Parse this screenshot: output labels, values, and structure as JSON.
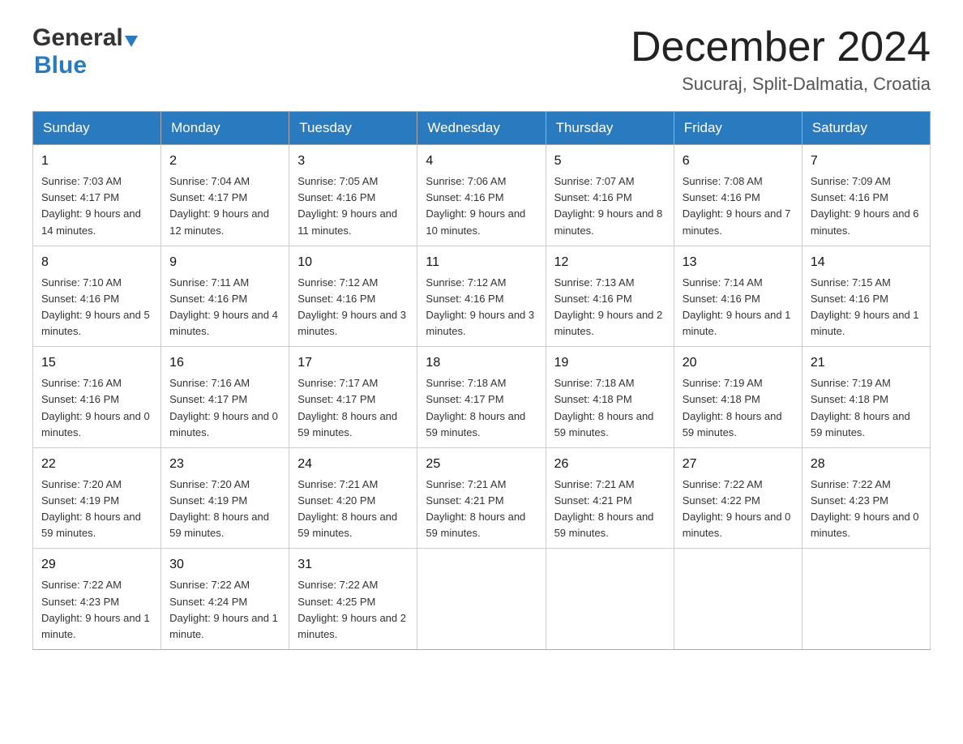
{
  "logo": {
    "general": "General",
    "blue": "Blue"
  },
  "header": {
    "month": "December 2024",
    "location": "Sucuraj, Split-Dalmatia, Croatia"
  },
  "days_of_week": [
    "Sunday",
    "Monday",
    "Tuesday",
    "Wednesday",
    "Thursday",
    "Friday",
    "Saturday"
  ],
  "weeks": [
    [
      {
        "day": "1",
        "sunrise": "7:03 AM",
        "sunset": "4:17 PM",
        "daylight": "9 hours and 14 minutes."
      },
      {
        "day": "2",
        "sunrise": "7:04 AM",
        "sunset": "4:17 PM",
        "daylight": "9 hours and 12 minutes."
      },
      {
        "day": "3",
        "sunrise": "7:05 AM",
        "sunset": "4:16 PM",
        "daylight": "9 hours and 11 minutes."
      },
      {
        "day": "4",
        "sunrise": "7:06 AM",
        "sunset": "4:16 PM",
        "daylight": "9 hours and 10 minutes."
      },
      {
        "day": "5",
        "sunrise": "7:07 AM",
        "sunset": "4:16 PM",
        "daylight": "9 hours and 8 minutes."
      },
      {
        "day": "6",
        "sunrise": "7:08 AM",
        "sunset": "4:16 PM",
        "daylight": "9 hours and 7 minutes."
      },
      {
        "day": "7",
        "sunrise": "7:09 AM",
        "sunset": "4:16 PM",
        "daylight": "9 hours and 6 minutes."
      }
    ],
    [
      {
        "day": "8",
        "sunrise": "7:10 AM",
        "sunset": "4:16 PM",
        "daylight": "9 hours and 5 minutes."
      },
      {
        "day": "9",
        "sunrise": "7:11 AM",
        "sunset": "4:16 PM",
        "daylight": "9 hours and 4 minutes."
      },
      {
        "day": "10",
        "sunrise": "7:12 AM",
        "sunset": "4:16 PM",
        "daylight": "9 hours and 3 minutes."
      },
      {
        "day": "11",
        "sunrise": "7:12 AM",
        "sunset": "4:16 PM",
        "daylight": "9 hours and 3 minutes."
      },
      {
        "day": "12",
        "sunrise": "7:13 AM",
        "sunset": "4:16 PM",
        "daylight": "9 hours and 2 minutes."
      },
      {
        "day": "13",
        "sunrise": "7:14 AM",
        "sunset": "4:16 PM",
        "daylight": "9 hours and 1 minute."
      },
      {
        "day": "14",
        "sunrise": "7:15 AM",
        "sunset": "4:16 PM",
        "daylight": "9 hours and 1 minute."
      }
    ],
    [
      {
        "day": "15",
        "sunrise": "7:16 AM",
        "sunset": "4:16 PM",
        "daylight": "9 hours and 0 minutes."
      },
      {
        "day": "16",
        "sunrise": "7:16 AM",
        "sunset": "4:17 PM",
        "daylight": "9 hours and 0 minutes."
      },
      {
        "day": "17",
        "sunrise": "7:17 AM",
        "sunset": "4:17 PM",
        "daylight": "8 hours and 59 minutes."
      },
      {
        "day": "18",
        "sunrise": "7:18 AM",
        "sunset": "4:17 PM",
        "daylight": "8 hours and 59 minutes."
      },
      {
        "day": "19",
        "sunrise": "7:18 AM",
        "sunset": "4:18 PM",
        "daylight": "8 hours and 59 minutes."
      },
      {
        "day": "20",
        "sunrise": "7:19 AM",
        "sunset": "4:18 PM",
        "daylight": "8 hours and 59 minutes."
      },
      {
        "day": "21",
        "sunrise": "7:19 AM",
        "sunset": "4:18 PM",
        "daylight": "8 hours and 59 minutes."
      }
    ],
    [
      {
        "day": "22",
        "sunrise": "7:20 AM",
        "sunset": "4:19 PM",
        "daylight": "8 hours and 59 minutes."
      },
      {
        "day": "23",
        "sunrise": "7:20 AM",
        "sunset": "4:19 PM",
        "daylight": "8 hours and 59 minutes."
      },
      {
        "day": "24",
        "sunrise": "7:21 AM",
        "sunset": "4:20 PM",
        "daylight": "8 hours and 59 minutes."
      },
      {
        "day": "25",
        "sunrise": "7:21 AM",
        "sunset": "4:21 PM",
        "daylight": "8 hours and 59 minutes."
      },
      {
        "day": "26",
        "sunrise": "7:21 AM",
        "sunset": "4:21 PM",
        "daylight": "8 hours and 59 minutes."
      },
      {
        "day": "27",
        "sunrise": "7:22 AM",
        "sunset": "4:22 PM",
        "daylight": "9 hours and 0 minutes."
      },
      {
        "day": "28",
        "sunrise": "7:22 AM",
        "sunset": "4:23 PM",
        "daylight": "9 hours and 0 minutes."
      }
    ],
    [
      {
        "day": "29",
        "sunrise": "7:22 AM",
        "sunset": "4:23 PM",
        "daylight": "9 hours and 1 minute."
      },
      {
        "day": "30",
        "sunrise": "7:22 AM",
        "sunset": "4:24 PM",
        "daylight": "9 hours and 1 minute."
      },
      {
        "day": "31",
        "sunrise": "7:22 AM",
        "sunset": "4:25 PM",
        "daylight": "9 hours and 2 minutes."
      },
      null,
      null,
      null,
      null
    ]
  ],
  "labels": {
    "sunrise": "Sunrise:",
    "sunset": "Sunset:",
    "daylight": "Daylight:"
  }
}
